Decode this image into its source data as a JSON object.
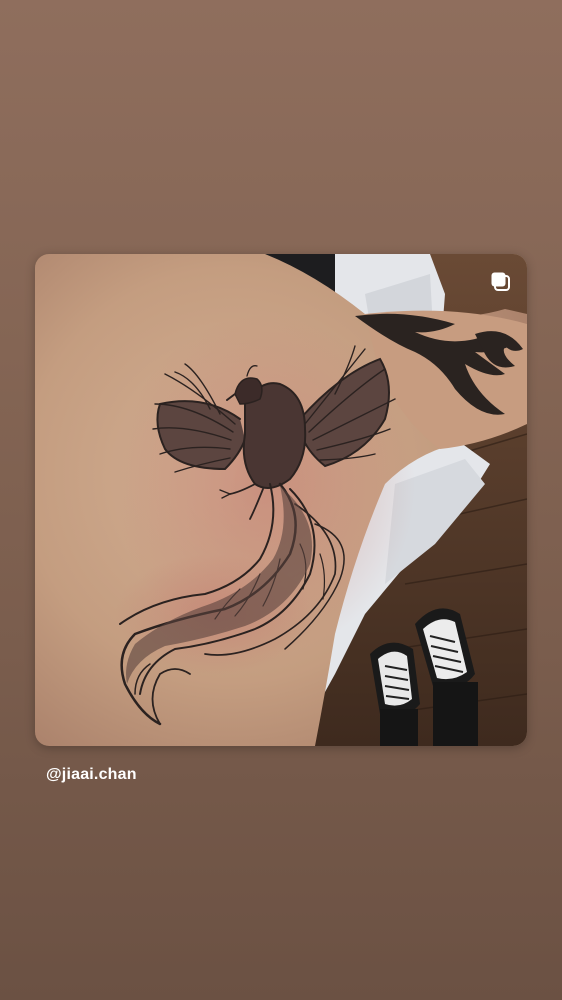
{
  "story": {
    "username": "@jiaai.chan",
    "background_top": "#8f6e5d",
    "background_bottom": "#6b5143"
  },
  "post": {
    "media_icon": "multiple-posts-icon",
    "image_subject": "phoenix-back-tattoo"
  }
}
